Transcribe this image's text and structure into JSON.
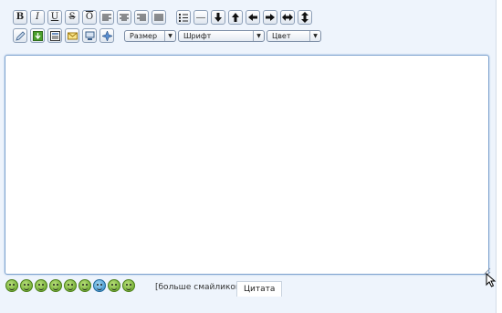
{
  "toolbar": {
    "row1_buttons": [
      {
        "name": "bold-button",
        "glyph": "B"
      },
      {
        "name": "italic-button",
        "glyph": "I"
      },
      {
        "name": "underline-button",
        "glyph": "U"
      },
      {
        "name": "strikethrough-button",
        "glyph": "S"
      },
      {
        "name": "overline-button",
        "glyph": "O"
      }
    ],
    "selects": {
      "size": "Размер",
      "font": "Шрифт",
      "color": "Цвет"
    }
  },
  "footer": {
    "more_smileys": "[больше смайликов]",
    "quote_tab": "Цитата"
  },
  "colors": {
    "panel_bg": "#eef4fc",
    "editor_border": "#7da2ce",
    "smiley_green": "#5f9e22",
    "smiley_blue": "#2d86c4"
  }
}
